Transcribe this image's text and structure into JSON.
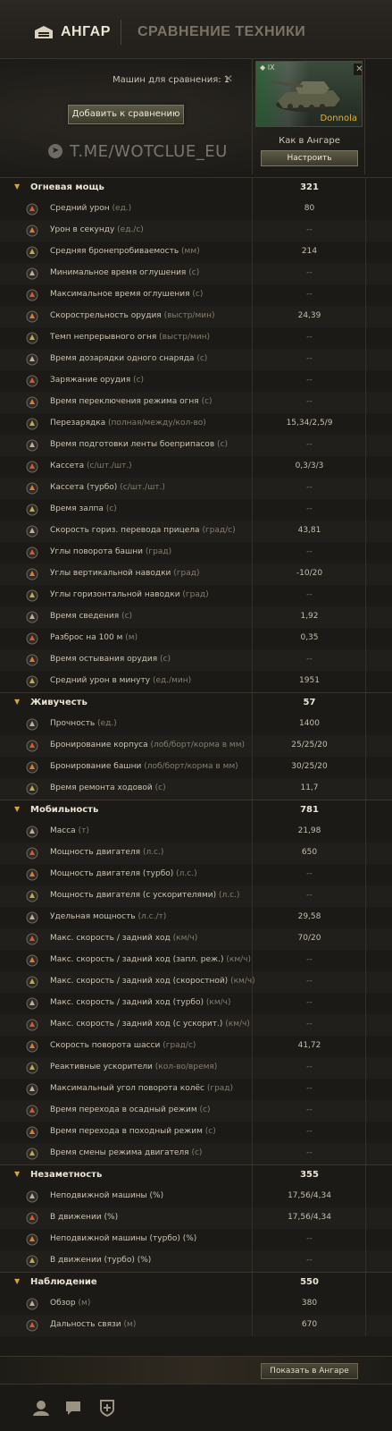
{
  "header": {
    "garage_label": "АНГАР",
    "compare_label": "СРАВНЕНИЕ ТЕХНИКИ"
  },
  "compare": {
    "count_label": "Машин для сравнения:",
    "count_value": "1",
    "clear_icon": "close-icon",
    "add_button": "Добавить к сравнению",
    "watermark": "T.ME/WOTCLUE_EU"
  },
  "vehicle": {
    "tier": "IX",
    "name": "Donnola",
    "config_label": "Как в Ангаре",
    "configure_button": "Настроить",
    "accent_color": "#e5b23a"
  },
  "sections": [
    {
      "title": "Огневая мощь",
      "value": "321",
      "rows": [
        {
          "icon": "damage-icon",
          "label": "Средний урон",
          "unit": "(ед.)",
          "value": "80"
        },
        {
          "icon": "dpm-burst-icon",
          "label": "Урон в секунду",
          "unit": "(ед./с)",
          "value": "--"
        },
        {
          "icon": "penetration-icon",
          "label": "Средняя бронепробиваемость",
          "unit": "(мм)",
          "value": "214"
        },
        {
          "icon": "stun-icon",
          "label": "Минимальное время оглушения",
          "unit": "(с)",
          "value": "--"
        },
        {
          "icon": "stun-icon",
          "label": "Максимальное время оглушения",
          "unit": "(с)",
          "value": "--"
        },
        {
          "icon": "rate-of-fire-icon",
          "label": "Скорострельность орудия",
          "unit": "(выстр/мин)",
          "value": "24,39"
        },
        {
          "icon": "continuous-fire-icon",
          "label": "Темп непрерывного огня",
          "unit": "(выстр/мин)",
          "value": "--"
        },
        {
          "icon": "shell-reload-icon",
          "label": "Время дозарядки одного снаряда",
          "unit": "(с)",
          "value": "--"
        },
        {
          "icon": "charge-icon",
          "label": "Заряжание орудия",
          "unit": "(с)",
          "value": "--"
        },
        {
          "icon": "fire-mode-icon",
          "label": "Время переключения режима огня",
          "unit": "(с)",
          "value": "--"
        },
        {
          "icon": "reload-icon",
          "label": "Перезарядка",
          "unit": "(полная/между/кол-во)",
          "value": "15,34/2,5/9"
        },
        {
          "icon": "ammo-belt-icon",
          "label": "Время подготовки ленты боеприпасов",
          "unit": "(с)",
          "value": "--"
        },
        {
          "icon": "clip-icon",
          "label": "Кассета",
          "unit": "(с/шт./шт.)",
          "value": "0,3/3/3"
        },
        {
          "icon": "clip-turbo-icon",
          "label": "Кассета (турбо)",
          "unit": "(с/шт./шт.)",
          "value": "--"
        },
        {
          "icon": "salvo-icon",
          "label": "Время залпа",
          "unit": "(с)",
          "value": "--"
        },
        {
          "icon": "traverse-icon",
          "label": "Скорость гориз. перевода прицела",
          "unit": "(град/с)",
          "value": "43,81"
        },
        {
          "icon": "turret-angles-icon",
          "label": "Углы поворота башни",
          "unit": "(град)",
          "value": "--"
        },
        {
          "icon": "elevation-icon",
          "label": "Углы вертикальной наводки",
          "unit": "(град)",
          "value": "-10/20"
        },
        {
          "icon": "horizontal-angles-icon",
          "label": "Углы горизонтальной наводки",
          "unit": "(град)",
          "value": "--"
        },
        {
          "icon": "aim-time-icon",
          "label": "Время сведения",
          "unit": "(с)",
          "value": "1,92"
        },
        {
          "icon": "dispersion-icon",
          "label": "Разброс на 100 м",
          "unit": "(м)",
          "value": "0,35"
        },
        {
          "icon": "cooling-icon",
          "label": "Время остывания орудия",
          "unit": "(с)",
          "value": "--"
        },
        {
          "icon": "dpm-icon",
          "label": "Средний урон в минуту",
          "unit": "(ед./мин)",
          "value": "1951"
        }
      ]
    },
    {
      "title": "Живучесть",
      "value": "57",
      "rows": [
        {
          "icon": "hp-icon",
          "label": "Прочность",
          "unit": "(ед.)",
          "value": "1400"
        },
        {
          "icon": "hull-armor-icon",
          "label": "Бронирование корпуса",
          "unit": "(лоб/борт/корма в мм)",
          "value": "25/25/20"
        },
        {
          "icon": "turret-armor-icon",
          "label": "Бронирование башни",
          "unit": "(лоб/борт/корма в мм)",
          "value": "30/25/20"
        },
        {
          "icon": "repair-icon",
          "label": "Время ремонта ходовой",
          "unit": "(с)",
          "value": "11,7"
        }
      ]
    },
    {
      "title": "Мобильность",
      "value": "781",
      "rows": [
        {
          "icon": "weight-icon",
          "label": "Масса",
          "unit": "(т)",
          "value": "21,98"
        },
        {
          "icon": "engine-icon",
          "label": "Мощность двигателя",
          "unit": "(л.с.)",
          "value": "650"
        },
        {
          "icon": "engine-turbo-icon",
          "label": "Мощность двигателя (турбо)",
          "unit": "(л.с.)",
          "value": "--"
        },
        {
          "icon": "engine-rocket-icon",
          "label": "Мощность двигателя (с ускорителями)",
          "unit": "(л.с.)",
          "value": "--"
        },
        {
          "icon": "power-ratio-icon",
          "label": "Удельная мощность",
          "unit": "(л.с./т)",
          "value": "29,58"
        },
        {
          "icon": "speed-icon",
          "label": "Макс. скорость / задний ход",
          "unit": "(км/ч)",
          "value": "70/20"
        },
        {
          "icon": "speed-wheel-icon",
          "label": "Макс. скорость / задний ход (запл. реж.)",
          "unit": "(км/ч)",
          "value": "--"
        },
        {
          "icon": "speed-fast-icon",
          "label": "Макс. скорость / задний ход (скоростной)",
          "unit": "(км/ч)",
          "value": "--"
        },
        {
          "icon": "speed-turbo-icon",
          "label": "Макс. скорость / задний ход (турбо)",
          "unit": "(км/ч)",
          "value": "--"
        },
        {
          "icon": "speed-rocket-icon",
          "label": "Макс. скорость / задний ход (с ускорит.)",
          "unit": "(км/ч)",
          "value": "--"
        },
        {
          "icon": "hull-traverse-icon",
          "label": "Скорость поворота шасси",
          "unit": "(град/с)",
          "value": "41,72"
        },
        {
          "icon": "rocket-booster-icon",
          "label": "Реактивные ускорители",
          "unit": "(кол-во/время)",
          "value": "--"
        },
        {
          "icon": "wheel-angle-icon",
          "label": "Максимальный угол поворота колёс",
          "unit": "(град)",
          "value": "--"
        },
        {
          "icon": "siege-mode-icon",
          "label": "Время перехода в осадный режим",
          "unit": "(с)",
          "value": "--"
        },
        {
          "icon": "travel-mode-icon",
          "label": "Время перехода в походный режим",
          "unit": "(с)",
          "value": "--"
        },
        {
          "icon": "engine-mode-icon",
          "label": "Время смены режима двигателя",
          "unit": "(с)",
          "value": "--"
        }
      ]
    },
    {
      "title": "Незаметность",
      "value": "355",
      "rows": [
        {
          "icon": "camo-stationary-icon",
          "label": "Неподвижной машины (%)",
          "unit": "",
          "value": "17,56/4,34"
        },
        {
          "icon": "camo-moving-icon",
          "label": "В движении (%)",
          "unit": "",
          "value": "17,56/4,34"
        },
        {
          "icon": "camo-stationary-turbo-icon",
          "label": "Неподвижной машины (турбо) (%)",
          "unit": "",
          "value": "--"
        },
        {
          "icon": "camo-moving-turbo-icon",
          "label": "В движении (турбо) (%)",
          "unit": "",
          "value": "--"
        }
      ]
    },
    {
      "title": "Наблюдение",
      "value": "550",
      "rows": [
        {
          "icon": "view-range-icon",
          "label": "Обзор",
          "unit": "(м)",
          "value": "380"
        },
        {
          "icon": "radio-range-icon",
          "label": "Дальность связи",
          "unit": "(м)",
          "value": "670"
        }
      ]
    }
  ],
  "show_in_hangar_button": "Показать в Ангаре",
  "footer_icons": [
    "user-icon",
    "chat-icon",
    "add-to-squad-icon"
  ]
}
